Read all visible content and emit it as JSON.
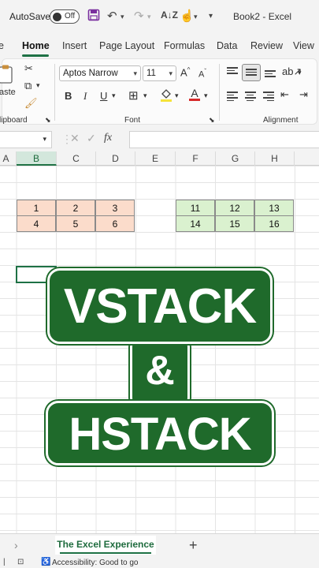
{
  "titlebar": {
    "autosave_label": "AutoSave",
    "toggle_label": "Off",
    "doc_title": "Book2  -  Excel"
  },
  "tabs": [
    "e",
    "Home",
    "Insert",
    "Page Layout",
    "Formulas",
    "Data",
    "Review",
    "View"
  ],
  "ribbon": {
    "clipboard": {
      "paste_label": "aste",
      "group_label": "lipboard"
    },
    "font": {
      "font_name": "Aptos Narrow",
      "font_size": "11",
      "group_label": "Font",
      "bold": "B",
      "italic": "I",
      "underline": "U"
    },
    "alignment": {
      "group_label": "Alignment"
    }
  },
  "formula_bar": {
    "fx_label": "fx",
    "cancel": "✕",
    "enter": "✓"
  },
  "columns": [
    "A",
    "B",
    "C",
    "D",
    "E",
    "F",
    "G",
    "H"
  ],
  "active_column": "B",
  "table_left": {
    "rows": [
      [
        "1",
        "2",
        "3"
      ],
      [
        "4",
        "5",
        "6"
      ]
    ],
    "fill": "#fbdccb"
  },
  "table_right": {
    "rows": [
      [
        "11",
        "12",
        "13"
      ],
      [
        "14",
        "15",
        "16"
      ]
    ],
    "fill": "#daf1cf"
  },
  "overlay": {
    "line1": "VSTACK",
    "line2": "&",
    "line3": "HSTACK",
    "color": "#1f6a2b"
  },
  "sheets": {
    "active": "The Excel Experience",
    "add": "+"
  },
  "status": {
    "accessibility": "Accessibility: Good to go"
  }
}
